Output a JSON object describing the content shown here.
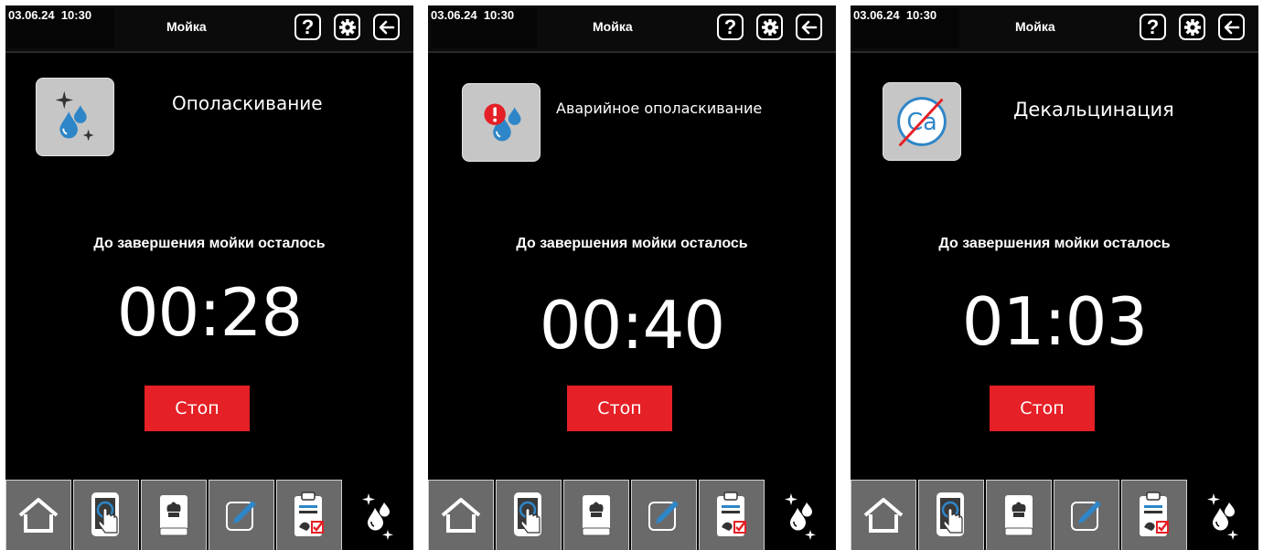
{
  "colors": {
    "accent_red": "#e52026",
    "drop_blue": "#2e86c8",
    "tab_gray": "#6a6a6a",
    "icon_tile": "#c6c6c6"
  },
  "screens": [
    {
      "datetime": "03.06.24  10:30",
      "title": "Мойка",
      "help_label": "?",
      "program_icon": "rinse-drops-icon",
      "program_name": "Ополаскивание",
      "remaining_label": "До завершения мойки осталось",
      "timer": "00:28",
      "stop_label": "Стоп"
    },
    {
      "datetime": "03.06.24  10:30",
      "title": "Мойка",
      "help_label": "?",
      "program_icon": "emergency-rinse-icon",
      "program_name": "Аварийное ополаскивание",
      "remaining_label": "До завершения мойки осталось",
      "timer": "00:40",
      "stop_label": "Стоп"
    },
    {
      "datetime": "03.06.24  10:30",
      "title": "Мойка",
      "help_label": "?",
      "program_icon": "decalcification-icon",
      "program_name": "Декальцинация",
      "calcium_symbol": "Ca",
      "remaining_label": "До завершения мойки осталось",
      "timer": "01:03",
      "stop_label": "Стоп"
    }
  ],
  "navbar": {
    "tabs": [
      "home-icon",
      "touch-tablet-icon",
      "cookbook-icon",
      "edit-icon",
      "haccp-checklist-icon",
      "washing-drops-icon"
    ],
    "active_tab": "washing-drops-icon"
  }
}
